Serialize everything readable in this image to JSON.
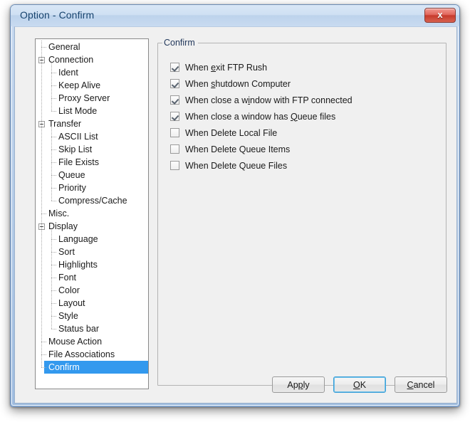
{
  "window": {
    "title": "Option - Confirm",
    "close_label": "×",
    "close_glyph": "x"
  },
  "colors": {
    "title_text": "#16436e",
    "selection": "#3399ee",
    "close_red": "#c63a2c",
    "default_button_focus": "#3c9fd8"
  },
  "tree": {
    "items": [
      {
        "label": "General",
        "depth": 1,
        "expander": false,
        "selected": false
      },
      {
        "label": "Connection",
        "depth": 0,
        "expander": true,
        "selected": false
      },
      {
        "label": "Ident",
        "depth": 2,
        "expander": false,
        "selected": false
      },
      {
        "label": "Keep Alive",
        "depth": 2,
        "expander": false,
        "selected": false
      },
      {
        "label": "Proxy Server",
        "depth": 2,
        "expander": false,
        "selected": false
      },
      {
        "label": "List Mode",
        "depth": 2,
        "expander": false,
        "selected": false
      },
      {
        "label": "Transfer",
        "depth": 0,
        "expander": true,
        "selected": false
      },
      {
        "label": "ASCII List",
        "depth": 2,
        "expander": false,
        "selected": false
      },
      {
        "label": "Skip List",
        "depth": 2,
        "expander": false,
        "selected": false
      },
      {
        "label": "File Exists",
        "depth": 2,
        "expander": false,
        "selected": false
      },
      {
        "label": "Queue",
        "depth": 2,
        "expander": false,
        "selected": false
      },
      {
        "label": "Priority",
        "depth": 2,
        "expander": false,
        "selected": false
      },
      {
        "label": "Compress/Cache",
        "depth": 2,
        "expander": false,
        "selected": false
      },
      {
        "label": "Misc.",
        "depth": 1,
        "expander": false,
        "selected": false
      },
      {
        "label": "Display",
        "depth": 0,
        "expander": true,
        "selected": false
      },
      {
        "label": "Language",
        "depth": 2,
        "expander": false,
        "selected": false
      },
      {
        "label": "Sort",
        "depth": 2,
        "expander": false,
        "selected": false
      },
      {
        "label": "Highlights",
        "depth": 2,
        "expander": false,
        "selected": false
      },
      {
        "label": "Font",
        "depth": 2,
        "expander": false,
        "selected": false
      },
      {
        "label": "Color",
        "depth": 2,
        "expander": false,
        "selected": false
      },
      {
        "label": "Layout",
        "depth": 2,
        "expander": false,
        "selected": false
      },
      {
        "label": "Style",
        "depth": 2,
        "expander": false,
        "selected": false
      },
      {
        "label": "Status bar",
        "depth": 2,
        "expander": false,
        "selected": false
      },
      {
        "label": "Mouse Action",
        "depth": 1,
        "expander": false,
        "selected": false
      },
      {
        "label": "File Associations",
        "depth": 1,
        "expander": false,
        "selected": false
      },
      {
        "label": "Confirm",
        "depth": 1,
        "expander": false,
        "selected": true
      }
    ]
  },
  "groupbox": {
    "title": "Confirm",
    "options": [
      {
        "label": "When exit FTP Rush",
        "accel_index": 5,
        "checked": true
      },
      {
        "label": "When shutdown Computer",
        "accel_index": 5,
        "checked": true
      },
      {
        "label": "When close a window with FTP connected",
        "accel_index": 14,
        "checked": true
      },
      {
        "label": "When close a window has Queue files",
        "accel_index": 24,
        "checked": true
      },
      {
        "label": "When Delete Local File",
        "accel_index": -1,
        "checked": false
      },
      {
        "label": "When Delete Queue Items",
        "accel_index": -1,
        "checked": false
      },
      {
        "label": "When Delete Queue Files",
        "accel_index": -1,
        "checked": false
      }
    ]
  },
  "buttons": [
    {
      "label": "Apply",
      "accel_index": 2,
      "default": false
    },
    {
      "label": "OK",
      "accel_index": 0,
      "default": true
    },
    {
      "label": "Cancel",
      "accel_index": 0,
      "default": false
    }
  ]
}
